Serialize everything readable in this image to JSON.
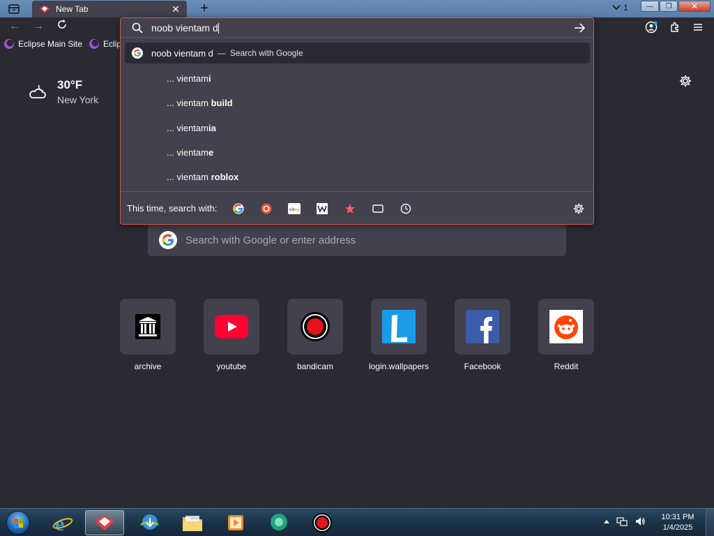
{
  "browser": {
    "tab": {
      "title": "New Tab",
      "close": "✕"
    },
    "new_tab": "+",
    "tab_count": "1",
    "window_controls": {
      "minimize": "—",
      "maximize": "❐",
      "close": "✕"
    },
    "nav": {
      "back": "←",
      "forward": "→"
    }
  },
  "bookmarks": [
    {
      "label": "Eclipse Main Site"
    },
    {
      "label": "Eclips"
    }
  ],
  "urlbar": {
    "value": "noob vientam d",
    "first_suggestion": {
      "text": "noob vientam d",
      "dash": "—",
      "hint": "Search with Google"
    },
    "suggestions": [
      {
        "prefix": "... vientam",
        "bold": "i"
      },
      {
        "prefix": "... vientam ",
        "bold": "build"
      },
      {
        "prefix": "... vientam",
        "bold": "ia"
      },
      {
        "prefix": "... vientam",
        "bold": "e"
      },
      {
        "prefix": "... vientam ",
        "bold": "roblox"
      }
    ],
    "oneoff_label": "This time, search with:",
    "oneoff_engines": [
      "google-icon",
      "duckduckgo-icon",
      "ebay-icon",
      "wikipedia-icon",
      "bookmarks-star-icon",
      "tabs-icon",
      "history-icon"
    ]
  },
  "weather": {
    "temperature": "30°F",
    "city": "New York"
  },
  "newtab_search": {
    "placeholder": "Search with Google or enter address"
  },
  "top_sites": [
    {
      "label": "archive",
      "icon": "archive-icon"
    },
    {
      "label": "youtube",
      "icon": "youtube-icon"
    },
    {
      "label": "bandicam",
      "icon": "bandicam-icon"
    },
    {
      "label": "login.wallpapers",
      "icon": "wallpapers-icon"
    },
    {
      "label": "Facebook",
      "icon": "facebook-icon"
    },
    {
      "label": "Reddit",
      "icon": "reddit-icon"
    }
  ],
  "taskbar": {
    "clock_time": "10:31 PM",
    "clock_date": "1/4/2025"
  },
  "colors": {
    "accent_border": "#d9584a",
    "background": "#2b2a33",
    "surface": "#42414d"
  }
}
